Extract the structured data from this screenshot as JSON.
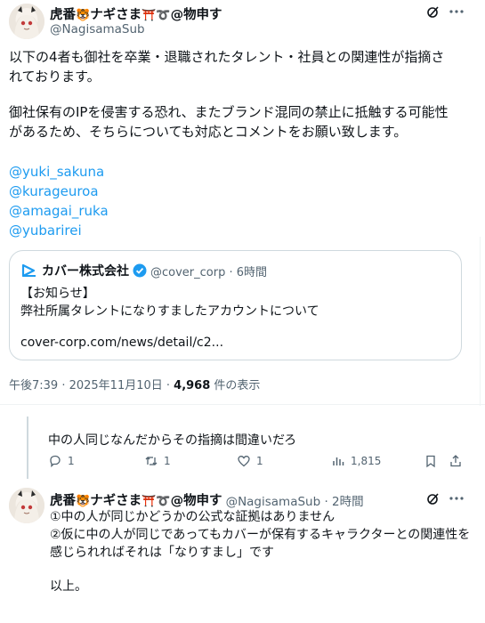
{
  "main_tweet": {
    "display_name": "虎番",
    "display_name_mid": "ナギさま",
    "display_name_suffix": "@物申す",
    "handle": "@NagisamaSub",
    "text_lines": [
      "以下の4者も御社を卒業・退職されたタレント・社員との関連性が指摘さ",
      "れております。",
      "",
      "御社保有のIPを侵害する恐れ、またブランド混同の禁止に抵触する可能性",
      "があるため、そちらについても対応とコメントをお願い致します。"
    ],
    "mentions": [
      "@yuki_sakuna",
      "@kurageuroa",
      "@amagai_ruka",
      "@yubarirei"
    ],
    "timestamp": "午後7:39 · 2025年11月10日 · ",
    "views_count": "4,968",
    "views_label": " 件の表示"
  },
  "quoted": {
    "account_name": "カバー株式会社",
    "meta": "@cover_corp · 6時間",
    "line1": "【お知らせ】",
    "line2": "弊社所属タレントになりすましたアカウントについて",
    "link": "cover-corp.com/news/detail/c2..."
  },
  "reply_parent": {
    "text": "中の人同じなんだからその指摘は間違いだろ",
    "replies": "1",
    "reposts": "1",
    "likes": "1",
    "views": "1,815"
  },
  "reply": {
    "display_name": "虎番",
    "display_name_mid": "ナギさま",
    "display_name_suffix": "@物申す",
    "meta": "@NagisamaSub · 2時間",
    "text_lines": [
      "①中の人が同じかどうかの公式な証拠はありません",
      "②仮に中の人が同じであってもカバーが保有するキャラクターとの関連性を",
      "感じられればそれは「なりすまし」です",
      "",
      "以上。"
    ]
  },
  "colors": {
    "accent": "#1d9bf0",
    "muted": "#536471",
    "text": "#0f1419",
    "border": "#cfd9de"
  }
}
